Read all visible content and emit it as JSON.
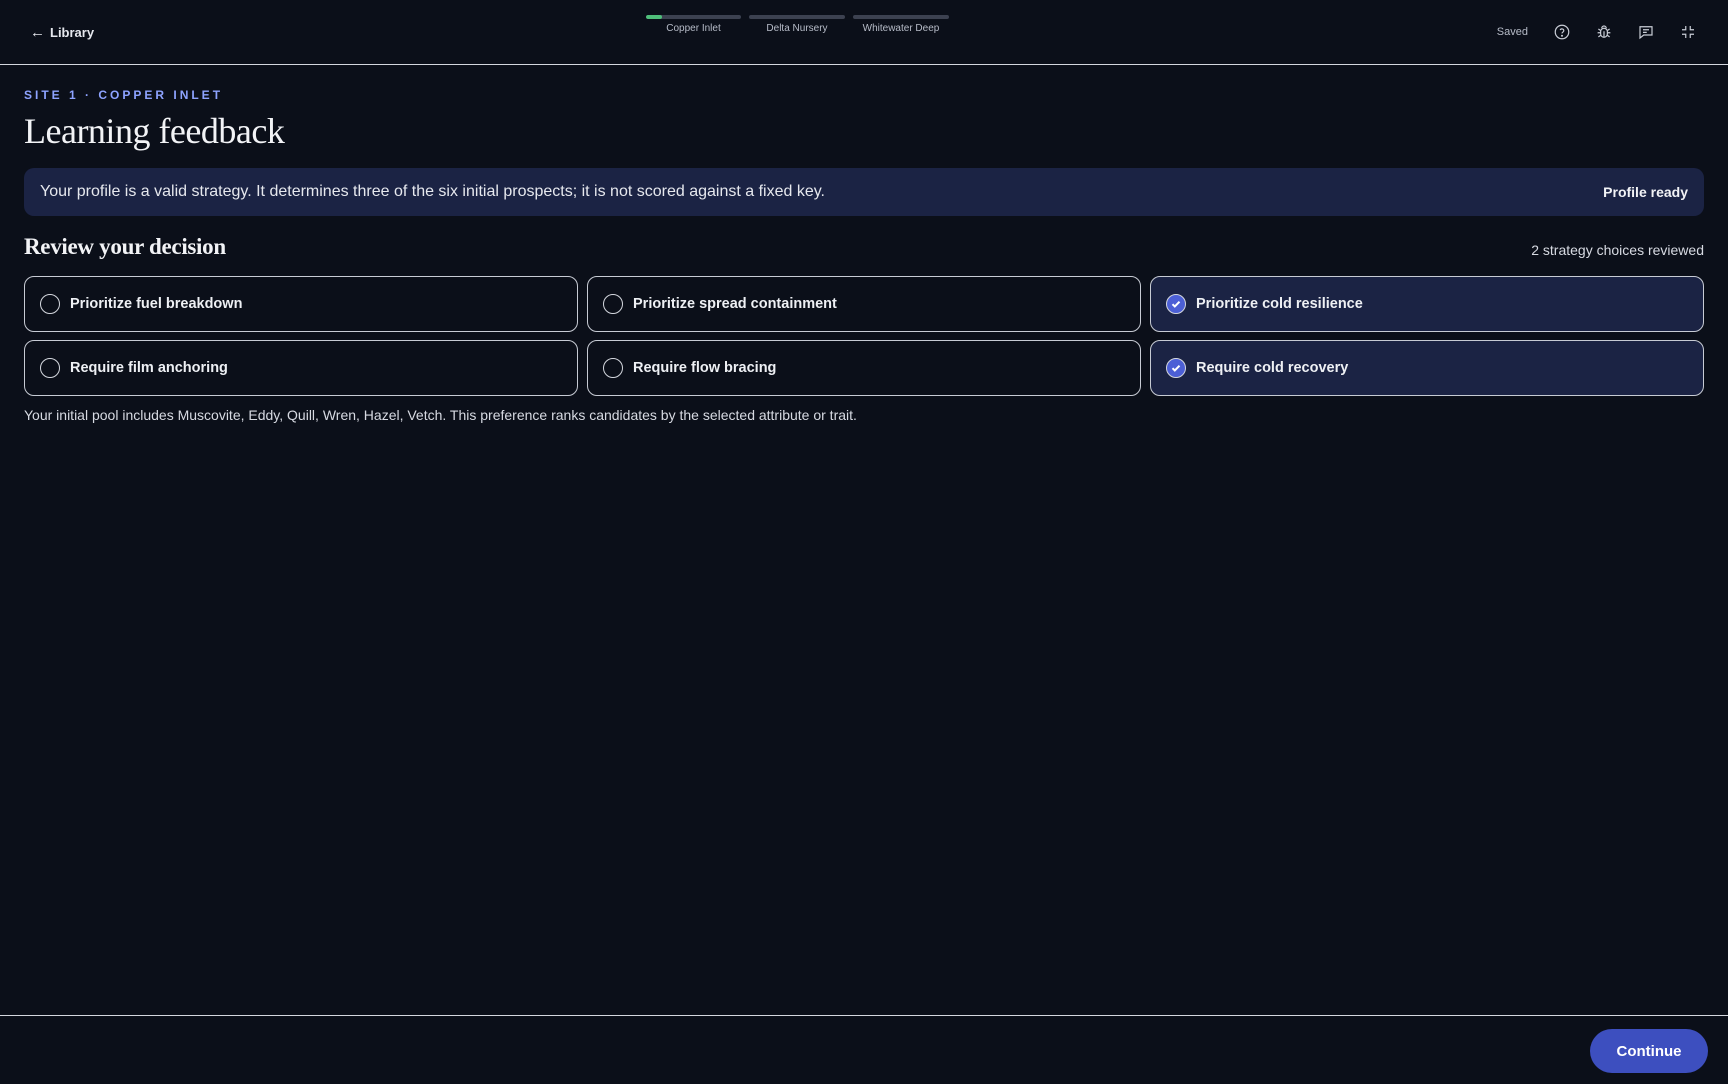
{
  "header": {
    "back_label": "Library",
    "saved_label": "Saved",
    "steps": [
      {
        "label": "Copper Inlet",
        "progress": 0.17
      },
      {
        "label": "Delta Nursery",
        "progress": 0
      },
      {
        "label": "Whitewater Deep",
        "progress": 0
      }
    ],
    "icons": [
      "help-icon",
      "bug-icon",
      "feedback-icon",
      "exit-fullscreen-icon"
    ],
    "accent_progress_color": "#4fbf7a"
  },
  "main": {
    "eyebrow": "SITE 1 · COPPER INLET",
    "title": "Learning feedback",
    "banner": {
      "text": "Your profile is a valid strategy. It determines three of the six initial prospects; it is not scored against a fixed key.",
      "status": "Profile ready"
    },
    "section_title": "Review your decision",
    "section_count": "2 strategy choices reviewed",
    "options": [
      {
        "label": "Prioritize fuel breakdown",
        "selected": false
      },
      {
        "label": "Prioritize spread containment",
        "selected": false
      },
      {
        "label": "Prioritize cold resilience",
        "selected": true
      },
      {
        "label": "Require film anchoring",
        "selected": false
      },
      {
        "label": "Require flow bracing",
        "selected": false
      },
      {
        "label": "Require cold recovery",
        "selected": true
      }
    ],
    "note": "Your initial pool includes Muscovite, Eddy, Quill, Wren, Hazel, Vetch. This preference ranks candidates by the selected attribute or trait."
  },
  "footer": {
    "continue_label": "Continue",
    "accent_color": "#3d4fbf"
  }
}
